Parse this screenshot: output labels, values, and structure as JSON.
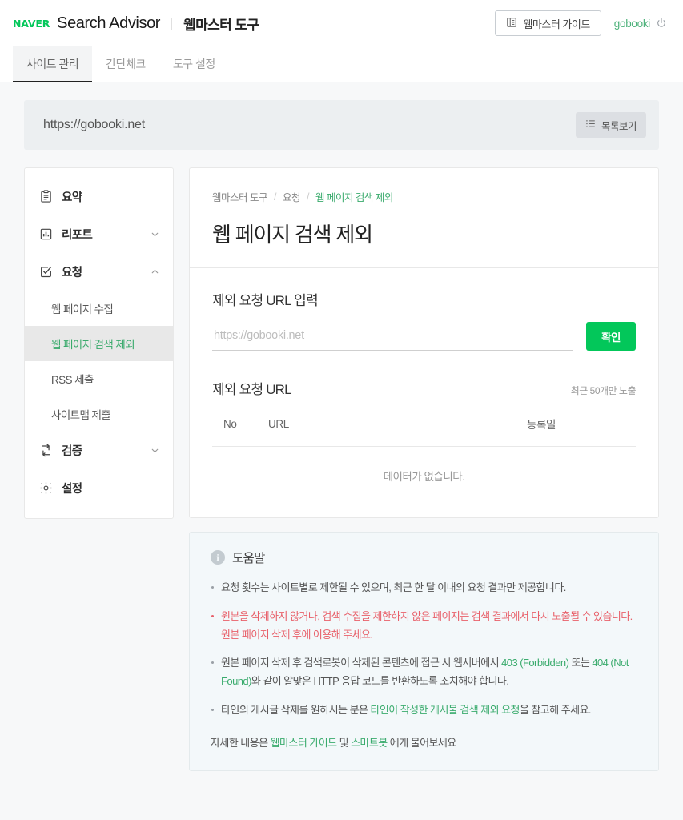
{
  "header": {
    "logo_text": "NAVER",
    "product_name": "Search Advisor",
    "section_name": "웹마스터 도구",
    "guide_button": "웹마스터 가이드",
    "guide_icon": "book-icon",
    "user_name": "gobooki",
    "logout_icon": "power-icon"
  },
  "tabs": [
    {
      "label": "사이트 관리",
      "active": true
    },
    {
      "label": "간단체크",
      "active": false
    },
    {
      "label": "도구 설정",
      "active": false
    }
  ],
  "site_bar": {
    "url": "https://gobooki.net",
    "list_button": "목록보기",
    "list_icon": "list-icon"
  },
  "sidebar": {
    "items": [
      {
        "label": "요약",
        "icon": "clipboard-icon",
        "expandable": false
      },
      {
        "label": "리포트",
        "icon": "bar-chart-icon",
        "expandable": true,
        "expanded": false
      },
      {
        "label": "요청",
        "icon": "checkbox-icon",
        "expandable": true,
        "expanded": true
      },
      {
        "label": "검증",
        "icon": "swap-arrows-icon",
        "expandable": true,
        "expanded": false
      },
      {
        "label": "설정",
        "icon": "gear-icon",
        "expandable": false
      }
    ],
    "request_subitems": [
      {
        "label": "웹 페이지 수집",
        "active": false
      },
      {
        "label": "웹 페이지 검색 제외",
        "active": true
      },
      {
        "label": "RSS 제출",
        "active": false
      },
      {
        "label": "사이트맵 제출",
        "active": false
      }
    ]
  },
  "main": {
    "breadcrumb": [
      "웹마스터 도구",
      "요청",
      "웹 페이지 검색 제외"
    ],
    "page_title": "웹 페이지 검색 제외",
    "input_section_label": "제외 요청 URL 입력",
    "url_input_placeholder": "https://gobooki.net",
    "url_input_value": "",
    "confirm_button": "확인",
    "table_title": "제외 요청 URL",
    "table_note": "최근 50개만 노출",
    "table_headers": [
      "No",
      "URL",
      "등록일"
    ],
    "table_rows": [],
    "empty_message": "데이터가 없습니다."
  },
  "help": {
    "icon": "info-icon",
    "title": "도움말",
    "items": [
      {
        "type": "normal",
        "parts": [
          {
            "text": "요청 횟수는 사이트별로 제한될 수 있으며, 최근 한 달 이내의 요청 결과만 제공합니다.",
            "style": "plain"
          }
        ]
      },
      {
        "type": "warn",
        "parts": [
          {
            "text": "원본을 삭제하지 않거나, 검색 수집을 제한하지 않은 페이지는 검색 결과에서 다시 노출될 수 있습니다. 원본 페이지 삭제 후에 이용해 주세요.",
            "style": "plain"
          }
        ]
      },
      {
        "type": "normal",
        "parts": [
          {
            "text": "원본 페이지 삭제 후 검색로봇이 삭제된 콘텐츠에 접근 시 웹서버에서 ",
            "style": "plain"
          },
          {
            "text": "403 (Forbidden)",
            "style": "green"
          },
          {
            "text": " 또는 ",
            "style": "plain"
          },
          {
            "text": "404 (Not Found)",
            "style": "green"
          },
          {
            "text": "와 같이 알맞은 HTTP 응답 코드를 반환하도록 조치해야 합니다.",
            "style": "plain"
          }
        ]
      },
      {
        "type": "normal",
        "parts": [
          {
            "text": "타인의 게시글 삭제를 원하시는 분은 ",
            "style": "plain"
          },
          {
            "text": "타인이 작성한 게시물 검색 제외 요청",
            "style": "green"
          },
          {
            "text": "을 참고해 주세요.",
            "style": "plain"
          }
        ]
      }
    ],
    "footer_parts": [
      {
        "text": "자세한 내용은 ",
        "style": "plain"
      },
      {
        "text": "웹마스터 가이드",
        "style": "green"
      },
      {
        "text": " 및 ",
        "style": "plain"
      },
      {
        "text": "스마트봇",
        "style": "green"
      },
      {
        "text": " 에게 물어보세요",
        "style": "plain"
      }
    ]
  },
  "colors": {
    "brand_green": "#03c75a",
    "link_green": "#3aab6d",
    "warn_red": "#e8606a",
    "page_bg": "#f7f8f9",
    "help_bg": "#f3f8fa"
  }
}
